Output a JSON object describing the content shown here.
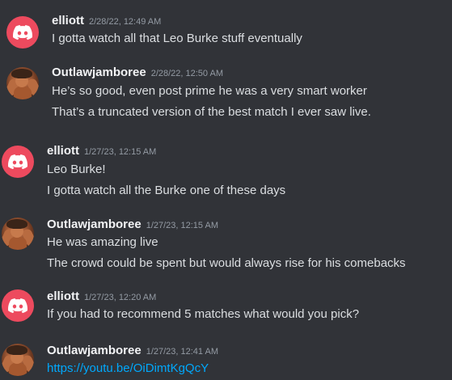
{
  "messages": [
    {
      "author": "elliott",
      "avatar": "discord-logo-avatar",
      "timestamp": "2/28/22, 12:49 AM",
      "lines": [
        "I gotta watch all that Leo Burke stuff eventually"
      ]
    },
    {
      "author": "Outlawjamboree",
      "avatar": "user-photo-avatar",
      "timestamp": "2/28/22, 12:50 AM",
      "lines": [
        "He’s so good, even post prime he was a very smart worker",
        "That’s a truncated version of the best match I ever saw live."
      ]
    },
    {
      "author": "elliott",
      "avatar": "discord-logo-avatar",
      "timestamp": "1/27/23, 12:15 AM",
      "lines": [
        "Leo Burke!",
        "I gotta watch all the Burke one of these days"
      ]
    },
    {
      "author": "Outlawjamboree",
      "avatar": "user-photo-avatar",
      "timestamp": "1/27/23, 12:15 AM",
      "lines": [
        "He was amazing live",
        "The crowd could be spent but would always rise for his comebacks"
      ]
    },
    {
      "author": "elliott",
      "avatar": "discord-logo-avatar",
      "timestamp": "1/27/23, 12:20 AM",
      "lines": [
        "If you had to recommend 5 matches what would you pick?"
      ]
    },
    {
      "author": "Outlawjamboree",
      "avatar": "user-photo-avatar",
      "timestamp": "1/27/23, 12:41 AM",
      "lines": [
        "https://youtu.be/OiDimtKgQcY"
      ]
    }
  ],
  "colors": {
    "background": "#313338",
    "username": "#f2f3f5",
    "timestamp": "#949ba4",
    "text": "#dbdee1",
    "link": "#00a8fc",
    "discord_avatar": "#ed4a5e"
  }
}
